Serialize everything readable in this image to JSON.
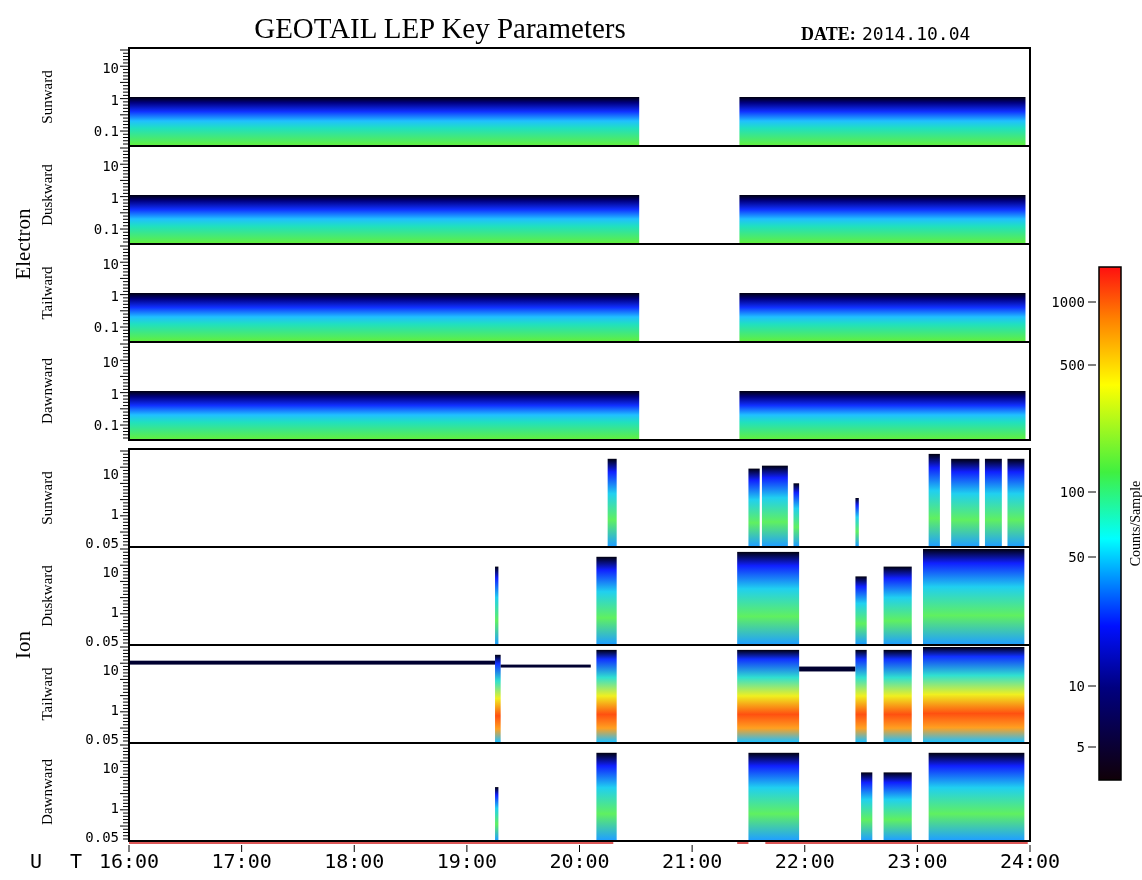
{
  "title": "GEOTAIL LEP Key Parameters",
  "date_label": "DATE:",
  "date": "2014.10.04",
  "groups": [
    {
      "name": "Electron",
      "panels": [
        {
          "label": "Sunward",
          "yticks": [
            "10",
            "1",
            "0.1"
          ]
        },
        {
          "label": "Duskward",
          "yticks": [
            "10",
            "1",
            "0.1"
          ]
        },
        {
          "label": "Tailward",
          "yticks": [
            "10",
            "1",
            "0.1"
          ]
        },
        {
          "label": "Dawnward",
          "yticks": [
            "10",
            "1",
            "0.1"
          ]
        }
      ]
    },
    {
      "name": "Ion",
      "panels": [
        {
          "label": "Sunward",
          "yticks": [
            "10",
            "1",
            "0.05"
          ]
        },
        {
          "label": "Duskward",
          "yticks": [
            "10",
            "1",
            "0.05"
          ]
        },
        {
          "label": "Tailward",
          "yticks": [
            "10",
            "1",
            "0.05"
          ]
        },
        {
          "label": "Dawnward",
          "yticks": [
            "10",
            "1",
            "0.05"
          ]
        }
      ]
    }
  ],
  "x_axis": {
    "label": "U T",
    "ticks": [
      "16:00",
      "17:00",
      "18:00",
      "19:00",
      "20:00",
      "21:00",
      "22:00",
      "23:00",
      "24:00"
    ]
  },
  "colorbar": {
    "title": "Counts/Sample",
    "ticks": [
      "1000",
      "500",
      "100",
      "50",
      "10",
      "5"
    ]
  }
}
